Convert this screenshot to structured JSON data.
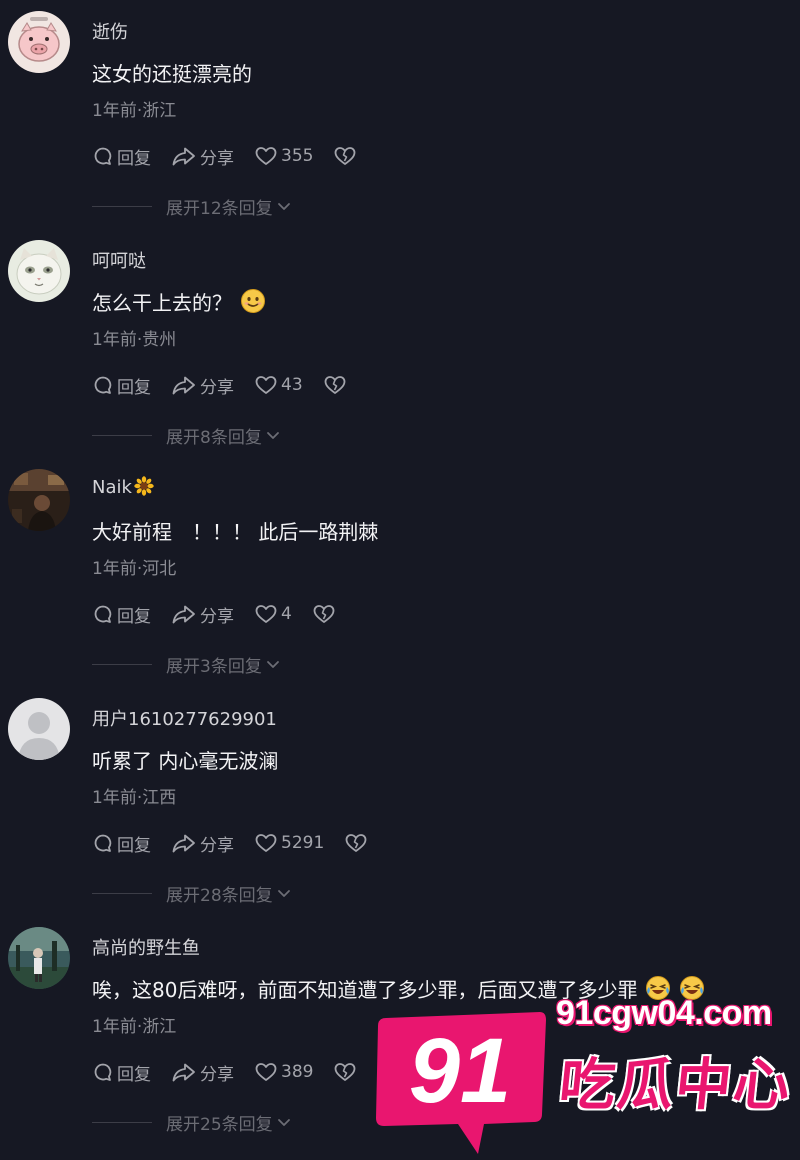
{
  "comments": [
    {
      "username": "逝伤",
      "text": "这女的还挺漂亮的",
      "meta": "1年前·浙江",
      "reply": "回复",
      "share": "分享",
      "likes": "355",
      "expand": "展开12条回复",
      "avatar": "pig-sticker-avatar"
    },
    {
      "username": "呵呵哒",
      "text": "怎么干上去的？",
      "meta": "1年前·贵州",
      "reply": "回复",
      "share": "分享",
      "likes": "43",
      "expand": "展开8条回复",
      "avatar": "cat-face-avatar"
    },
    {
      "username": "Naik",
      "text": "大好前程　！！！ 此后一路荆棘",
      "meta": "1年前·河北",
      "reply": "回复",
      "share": "分享",
      "likes": "4",
      "expand": "展开3条回复",
      "avatar": "dark-photo-avatar"
    },
    {
      "username": "用户1610277629901",
      "text": "听累了  内心毫无波澜",
      "meta": "1年前·江西",
      "reply": "回复",
      "share": "分享",
      "likes": "5291",
      "expand": "展开28条回复",
      "avatar": "default-user-avatar"
    },
    {
      "username": "高尚的野生鱼",
      "text": "唉，这80后难呀，前面不知道遭了多少罪，后面又遭了多少罪",
      "meta": "1年前·浙江",
      "reply": "回复",
      "share": "分享",
      "likes": "389",
      "expand": "展开25条回复",
      "avatar": "outdoor-photo-avatar"
    }
  ],
  "watermark": {
    "number": "91",
    "url": "91cgw04.com",
    "name": "吃瓜中心"
  },
  "colors": {
    "background": "#161823",
    "accent": "#e9166f"
  }
}
